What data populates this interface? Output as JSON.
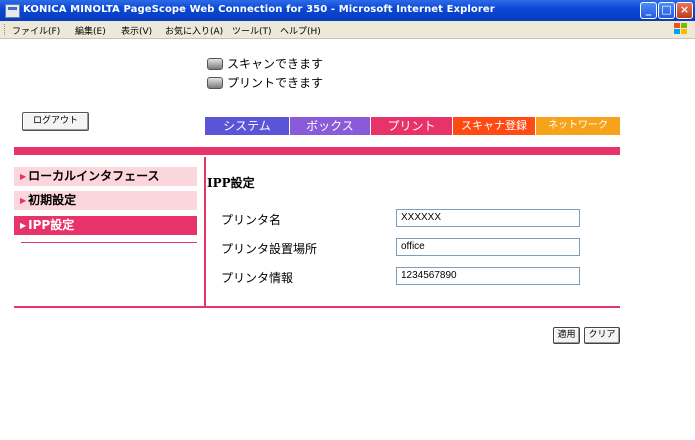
{
  "window": {
    "title": "KONICA MINOLTA PageScope Web Connection for 350 - Microsoft Internet Explorer"
  },
  "menubar": {
    "items": [
      "ファイル(F)",
      "編集(E)",
      "表示(V)",
      "お気に入り(A)",
      "ツール(T)",
      "ヘルプ(H)"
    ]
  },
  "status": {
    "scan": "スキャンできます",
    "print": "プリントできます"
  },
  "logout_label": "ログアウト",
  "tabs": [
    {
      "label": "システム",
      "color": "#5a55d6"
    },
    {
      "label": "ボックス",
      "color": "#8a5bd8"
    },
    {
      "label": "プリント",
      "color": "#e8326a"
    },
    {
      "label": "スキャナ登録",
      "color": "#ff4a14"
    },
    {
      "label": "ネットワーク",
      "color": "#f7a21b"
    }
  ],
  "sidebar": {
    "items": [
      {
        "label": "ローカルインタフェース",
        "active": false
      },
      {
        "label": "初期設定",
        "active": false
      },
      {
        "label": "IPP設定",
        "active": true
      }
    ]
  },
  "main": {
    "title": "IPP設定",
    "fields": [
      {
        "label": "プリンタ名",
        "value": "XXXXXX"
      },
      {
        "label": "プリンタ設置場所",
        "value": "office"
      },
      {
        "label": "プリンタ情報",
        "value": "1234567890"
      }
    ]
  },
  "buttons": {
    "apply": "適用",
    "clear": "クリア"
  },
  "colors": {
    "accent": "#e8326a",
    "sidebar_bg": "#fcd6dd",
    "titlebar": "#0a49d6"
  }
}
